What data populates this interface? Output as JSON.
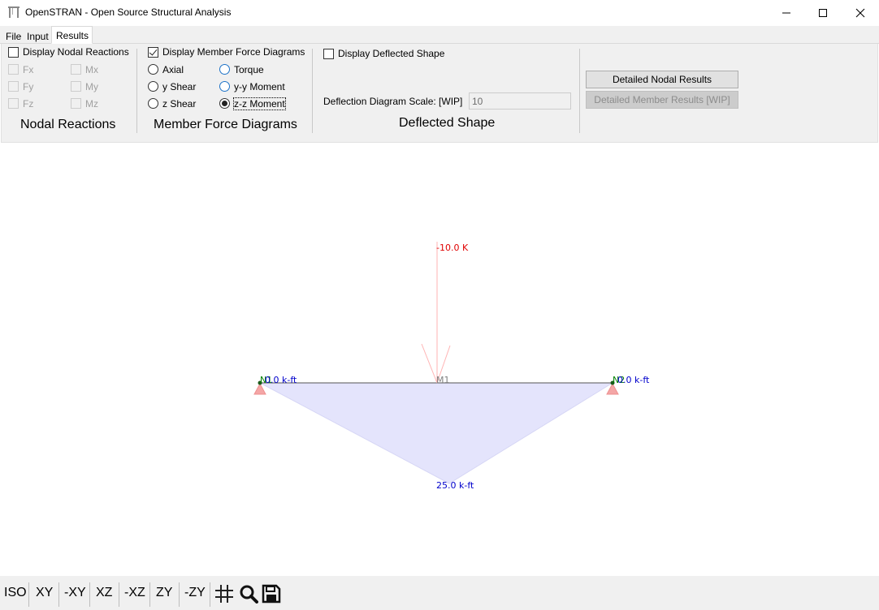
{
  "window": {
    "title": "OpenSTRAN - Open Source Structural Analysis",
    "icons": [
      "app-icon",
      "minimize-icon",
      "maximize-icon",
      "close-icon"
    ]
  },
  "tabs": [
    {
      "label": "File",
      "active": false
    },
    {
      "label": "Input",
      "active": false
    },
    {
      "label": "Results",
      "active": true
    }
  ],
  "nodal_reactions": {
    "display_label": "Display Nodal Reactions",
    "display_checked": false,
    "items": [
      {
        "label": "Fx",
        "checked": false,
        "enabled": false
      },
      {
        "label": "Mx",
        "checked": false,
        "enabled": false
      },
      {
        "label": "Fy",
        "checked": false,
        "enabled": false
      },
      {
        "label": "My",
        "checked": false,
        "enabled": false
      },
      {
        "label": "Fz",
        "checked": false,
        "enabled": false
      },
      {
        "label": "Mz",
        "checked": false,
        "enabled": false
      }
    ],
    "group_title": "Nodal Reactions"
  },
  "member_force": {
    "display_label": "Display Member Force Diagrams",
    "display_checked": true,
    "options": [
      {
        "label": "Axial",
        "selected": false
      },
      {
        "label": "Torque",
        "selected": false
      },
      {
        "label": "y Shear",
        "selected": false
      },
      {
        "label": "y-y Moment",
        "selected": false
      },
      {
        "label": "z Shear",
        "selected": false
      },
      {
        "label": "z-z Moment",
        "selected": true
      }
    ],
    "group_title": "Member Force Diagrams"
  },
  "deflected": {
    "display_label": "Display Deflected Shape",
    "display_checked": false,
    "scale_label": "Deflection Diagram Scale: [WIP]",
    "scale_value": "10",
    "group_title": "Deflected Shape"
  },
  "results_buttons": {
    "nodal": "Detailed Nodal Results",
    "member": "Detailed Member Results [WIP]"
  },
  "model": {
    "load_label": "-10.0 K",
    "member_label": "M1",
    "node1_label": "N1",
    "node2_label": "N2",
    "node1_moment": "0.0 k-ft",
    "node2_moment": "0.0 k-ft",
    "max_moment_label": "25.0 k-ft",
    "colors": {
      "load": "#ff0000",
      "moment_fill": "#e4e4fc",
      "moment_text": "#0000cc",
      "node_text": "#007f00",
      "support": "#f4a6a6"
    }
  },
  "view_toolbar": {
    "views": [
      "ISO",
      "XY",
      "-XY",
      "XZ",
      "-XZ",
      "ZY",
      "-ZY"
    ],
    "icons": [
      "grid-icon",
      "search-icon",
      "save-icon"
    ]
  }
}
